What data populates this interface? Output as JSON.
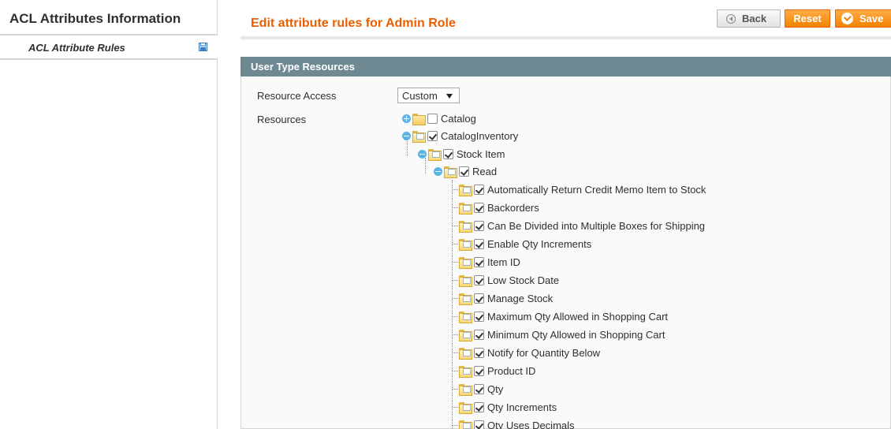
{
  "sidebar": {
    "title": "ACL Attributes Information",
    "items": [
      {
        "label": "ACL Attribute Rules",
        "icon": "save-disk-icon"
      }
    ]
  },
  "header": {
    "title": "Edit attribute rules for Admin Role",
    "back_label": "Back",
    "reset_label": "Reset",
    "save_label": "Save"
  },
  "panel": {
    "title": "User Type Resources",
    "resource_access_label": "Resource Access",
    "resource_access_value": "Custom",
    "resources_label": "Resources"
  },
  "tree": {
    "catalog": {
      "label": "Catalog",
      "checked": false,
      "expanded": false
    },
    "catalog_inventory": {
      "label": "CatalogInventory",
      "checked": true,
      "expanded": true
    },
    "stock_item": {
      "label": "Stock Item",
      "checked": true,
      "expanded": true
    },
    "read": {
      "label": "Read",
      "checked": true,
      "expanded": true
    },
    "leaves": [
      "Automatically Return Credit Memo Item to Stock",
      "Backorders",
      "Can Be Divided into Multiple Boxes for Shipping",
      "Enable Qty Increments",
      "Item ID",
      "Low Stock Date",
      "Manage Stock",
      "Maximum Qty Allowed in Shopping Cart",
      "Minimum Qty Allowed in Shopping Cart",
      "Notify for Quantity Below",
      "Product ID",
      "Qty",
      "Qty Increments",
      "Qty Uses Decimals"
    ]
  },
  "colors": {
    "accent": "#eb5e00",
    "panel_header": "#6f8992",
    "button_orange": "#f18200"
  }
}
